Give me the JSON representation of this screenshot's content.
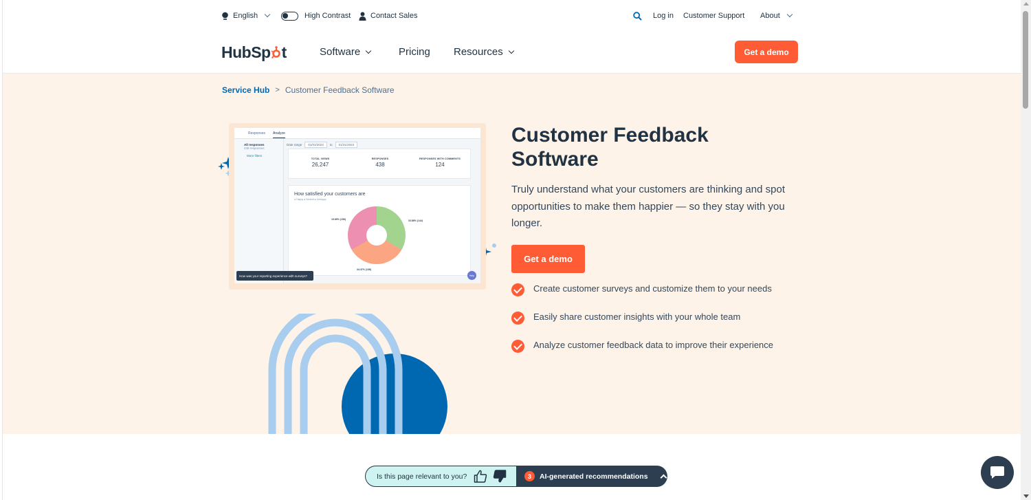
{
  "utility": {
    "language": "English",
    "high_contrast": "High Contrast",
    "contact_sales": "Contact Sales",
    "login": "Log in",
    "customer_support": "Customer Support",
    "about": "About"
  },
  "nav": {
    "logo": {
      "part1": "HubSp",
      "part2": "t"
    },
    "items": [
      {
        "label": "Software",
        "has_dropdown": true
      },
      {
        "label": "Pricing",
        "has_dropdown": false
      },
      {
        "label": "Resources",
        "has_dropdown": true
      }
    ],
    "cta": "Get a demo"
  },
  "breadcrumb": {
    "parent": "Service Hub",
    "separator": ">",
    "current": "Customer Feedback Software"
  },
  "screenshot": {
    "tabs": [
      "Responses",
      "Analyze"
    ],
    "active_tab": "Analyze",
    "sidebar_title": "All responses",
    "sidebar_sub": "438 responses",
    "more_filters": "More filters",
    "date_label": "Date range",
    "date_from": "01/01/2023",
    "date_to_word": "to",
    "date_to": "01/31/2023",
    "stats": [
      {
        "label": "TOTAL VIEWS",
        "value": "26,247"
      },
      {
        "label": "RESPONSES",
        "value": "438"
      },
      {
        "label": "RESPONSES WITH COMMENTS",
        "value": "124"
      }
    ],
    "chart_title": "How satisfied your customers are",
    "chart_legend": "● Happy   ● Neutral   ● Unhappy",
    "pct_left": "15.89% (156)",
    "pct_right": "33.88% (144)",
    "pct_bottom": "34.47% (138)",
    "survey_prompt": "How was your reporting experience with surveys?",
    "help": "Help"
  },
  "hero": {
    "title": "Customer Feedback Software",
    "description": "Truly understand what your customers are thinking and spot opportunities to make them happier — so they stay with you longer.",
    "cta": "Get a demo",
    "features": [
      "Create customer surveys and customize them to your needs",
      "Easily share customer insights with your whole team",
      "Analyze customer feedback data to improve their experience"
    ]
  },
  "feedback_bar": {
    "question": "Is this page relevant to you?",
    "badge_count": "3",
    "recommendations": "AI-generated recommendations"
  },
  "colors": {
    "brand_orange": "#ff5c35",
    "navy": "#213343",
    "hero_bg": "#fdf3e9",
    "link_blue": "#0068b1"
  }
}
